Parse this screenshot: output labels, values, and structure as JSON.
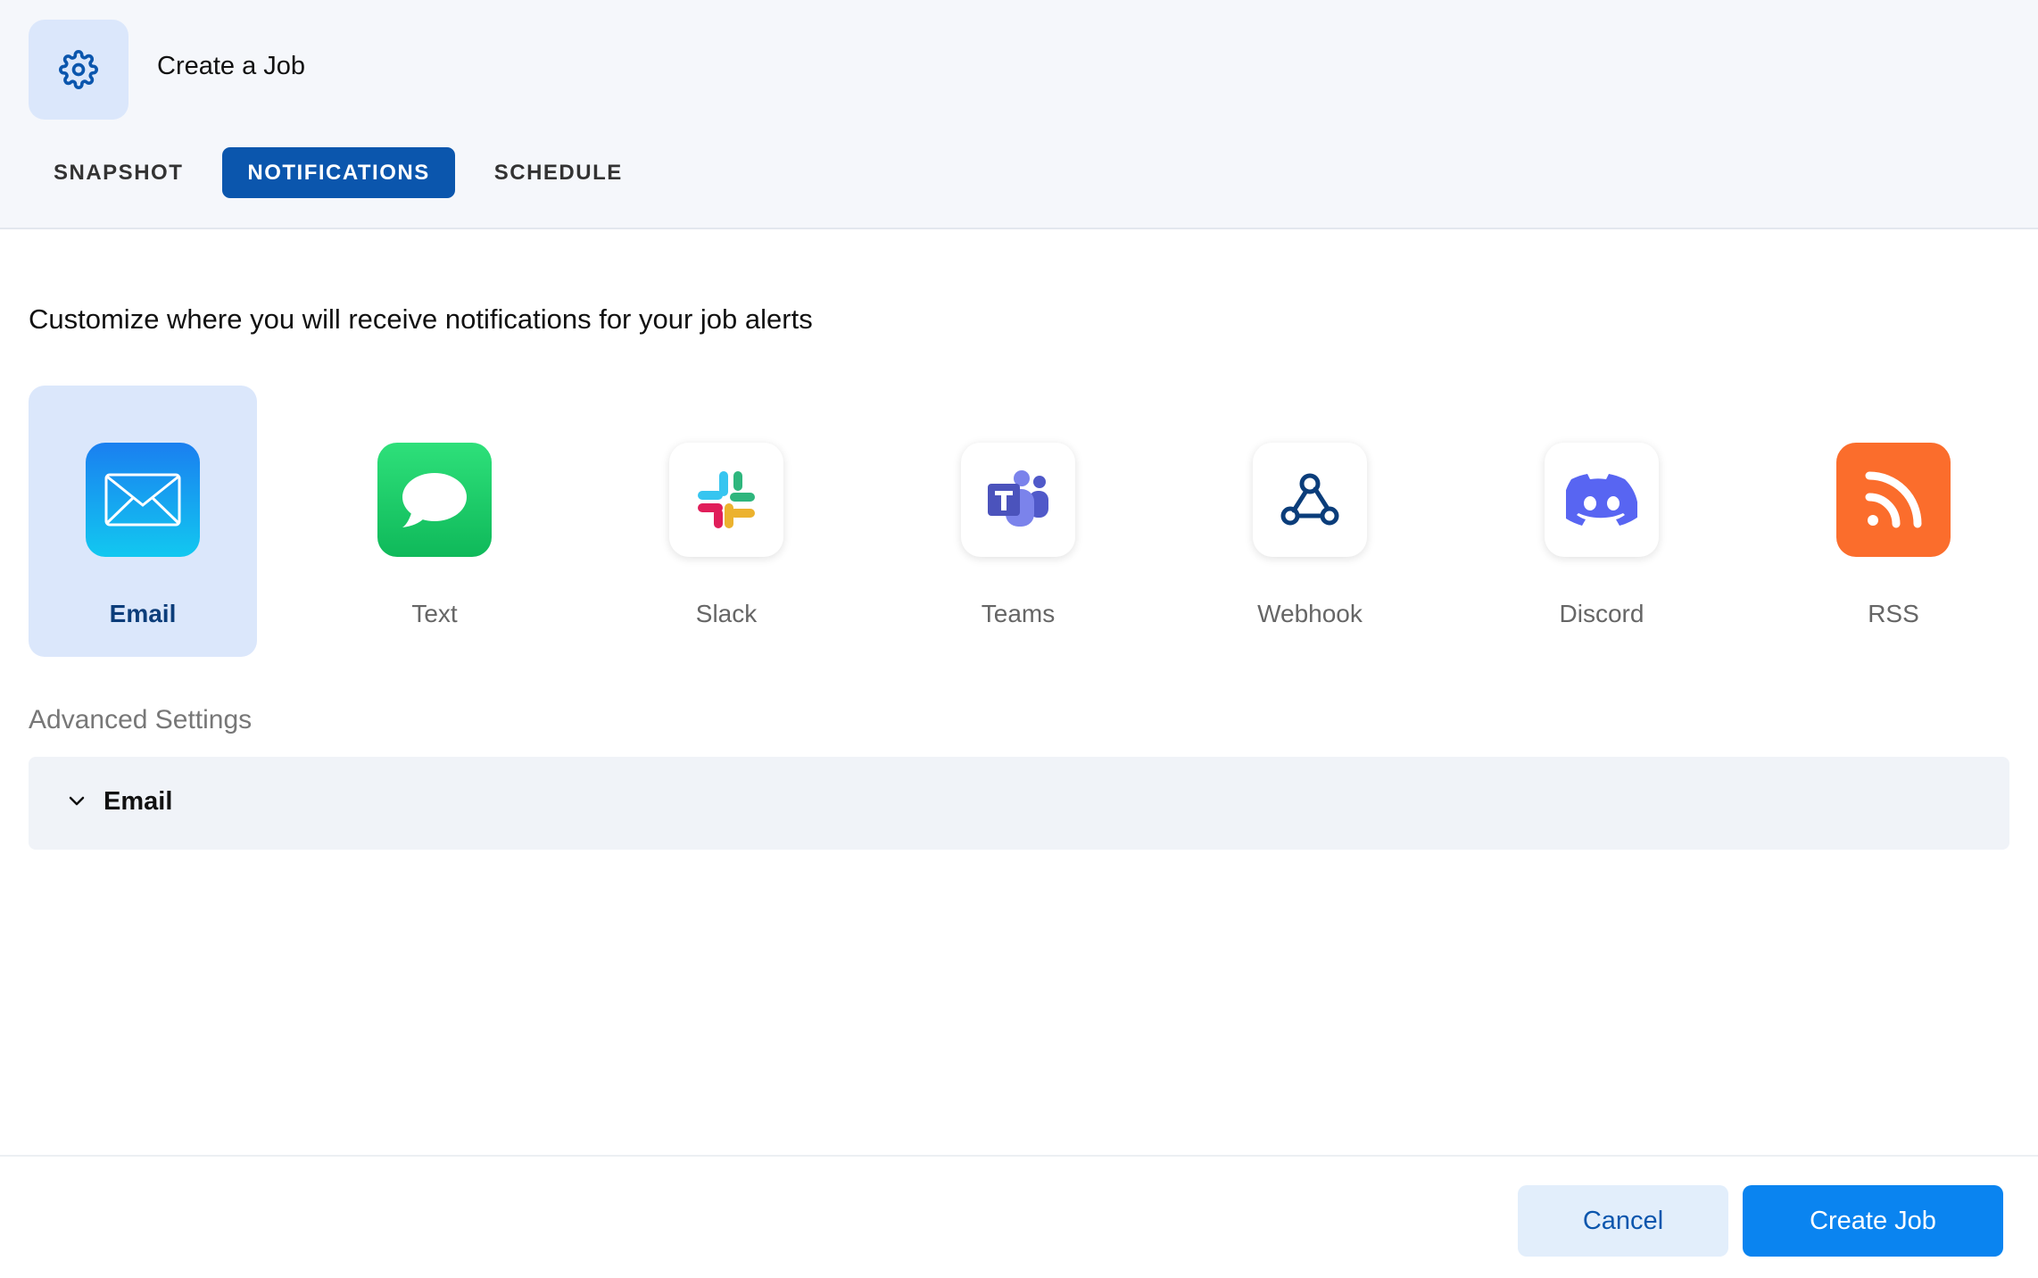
{
  "header": {
    "title": "Create a Job",
    "icon": "gear-icon",
    "tabs": [
      {
        "label": "SNAPSHOT",
        "active": false
      },
      {
        "label": "NOTIFICATIONS",
        "active": true
      },
      {
        "label": "SCHEDULE",
        "active": false
      }
    ]
  },
  "main": {
    "heading": "Customize where you will receive notifications for your job alerts",
    "channels": [
      {
        "label": "Email",
        "icon": "email-icon",
        "selected": true,
        "color": "#1a8cf0"
      },
      {
        "label": "Text",
        "icon": "message-bubble-icon",
        "selected": false,
        "color": "#22c55e"
      },
      {
        "label": "Slack",
        "icon": "slack-icon",
        "selected": false
      },
      {
        "label": "Teams",
        "icon": "teams-icon",
        "selected": false,
        "color": "#5059c9"
      },
      {
        "label": "Webhook",
        "icon": "webhook-icon",
        "selected": false,
        "color": "#0b3d7a"
      },
      {
        "label": "Discord",
        "icon": "discord-icon",
        "selected": false,
        "color": "#5865f2"
      },
      {
        "label": "RSS",
        "icon": "rss-icon",
        "selected": false,
        "color": "#f97316"
      }
    ],
    "advanced": {
      "label": "Advanced Settings",
      "panel_title": "Email",
      "expanded": false
    }
  },
  "footer": {
    "cancel_label": "Cancel",
    "create_label": "Create Job"
  },
  "colors": {
    "accent": "#0b56ad",
    "primary_button": "#0a84f0",
    "selected_bg": "#dbe7fb"
  }
}
